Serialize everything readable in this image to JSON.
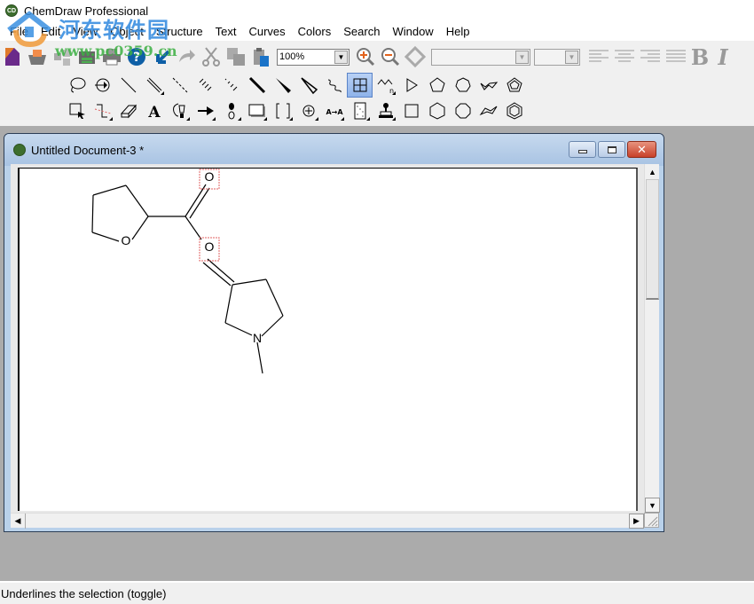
{
  "app": {
    "title": "ChemDraw Professional",
    "logo_text": "CD"
  },
  "menu": {
    "items": [
      "File",
      "Edit",
      "View",
      "Object",
      "Structure",
      "Text",
      "Curves",
      "Colors",
      "Search",
      "Window",
      "Help"
    ]
  },
  "watermark": {
    "cn_text": "河东软件园",
    "url_text": "www.pc0359.cn"
  },
  "toolbar": {
    "buttons": [
      {
        "name": "new-document",
        "icon": "new-document-icon"
      },
      {
        "name": "open",
        "icon": "open-folder-icon"
      },
      {
        "name": "template",
        "icon": "template-icon"
      },
      {
        "name": "save",
        "icon": "save-icon"
      },
      {
        "name": "print",
        "icon": "print-icon"
      },
      {
        "name": "help",
        "icon": "help-icon"
      },
      {
        "name": "undo",
        "icon": "undo-icon"
      },
      {
        "name": "redo",
        "icon": "redo-icon"
      },
      {
        "name": "cut",
        "icon": "scissors-icon"
      },
      {
        "name": "copy",
        "icon": "copy-icon"
      },
      {
        "name": "paste",
        "icon": "paste-icon"
      }
    ],
    "zoom_value": "100%",
    "zoom_in_icon": "zoom-in-icon",
    "zoom_out_icon": "zoom-out-icon",
    "show_crosshair_icon": "diamond-icon",
    "font_value": "",
    "font_size_value": "",
    "align": [
      "align-left",
      "align-center",
      "align-right",
      "justify"
    ],
    "bold_label": "B",
    "italic_label": "I",
    "colors": {
      "accent_blue": "#3a8fe0",
      "disabled_gray": "#9a9a9a"
    }
  },
  "tools": {
    "row1": [
      {
        "name": "lasso",
        "icon": "lasso-icon"
      },
      {
        "name": "structure-perspective",
        "icon": "rotate-3d-icon"
      },
      {
        "name": "solid-bond",
        "icon": "single-bond-icon"
      },
      {
        "name": "multiple-bond",
        "icon": "double-bond-icon",
        "submenu": true
      },
      {
        "name": "dashed-bond",
        "icon": "dashed-bond-icon"
      },
      {
        "name": "hashed-bond",
        "icon": "hashed-bond-icon"
      },
      {
        "name": "hashed-wedged-bond",
        "icon": "hashed-wedge-icon"
      },
      {
        "name": "bold-bond",
        "icon": "bold-bond-icon"
      },
      {
        "name": "wedged-bond",
        "icon": "wedge-bond-icon"
      },
      {
        "name": "hollow-wedged-bond",
        "icon": "hollow-wedge-icon"
      },
      {
        "name": "wavy-bond",
        "icon": "wavy-bond-icon"
      },
      {
        "name": "table",
        "icon": "grid-icon",
        "active": true
      },
      {
        "name": "acyclic-chain",
        "icon": "chain-icon",
        "submenu": true
      },
      {
        "name": "cyclopropane",
        "icon": "triangle-icon"
      },
      {
        "name": "cyclopentane",
        "icon": "pentagon-icon"
      },
      {
        "name": "cycloheptane",
        "icon": "heptagon-icon"
      },
      {
        "name": "cyclohexane-chair-1",
        "icon": "chair-icon"
      },
      {
        "name": "cyclopentadiene",
        "icon": "cyclopentadiene-icon"
      }
    ],
    "row2": [
      {
        "name": "marquee",
        "icon": "marquee-select-icon"
      },
      {
        "name": "mass-fragmentation",
        "icon": "fragmentation-icon",
        "submenu": true
      },
      {
        "name": "eraser",
        "icon": "eraser-icon"
      },
      {
        "name": "text",
        "icon": "text-tool-icon",
        "label": "A"
      },
      {
        "name": "pen",
        "icon": "pen-icon",
        "submenu": true
      },
      {
        "name": "arrow",
        "icon": "arrow-icon",
        "submenu": true
      },
      {
        "name": "orbital",
        "icon": "orbital-icon",
        "submenu": true
      },
      {
        "name": "drawing-elements",
        "icon": "rectangle-icon",
        "submenu": true
      },
      {
        "name": "brackets",
        "icon": "brackets-icon",
        "submenu": true
      },
      {
        "name": "chemical-symbols",
        "icon": "charge-plus-icon",
        "submenu": true
      },
      {
        "name": "query",
        "icon": "atom-map-icon",
        "label": "A→A",
        "submenu": true
      },
      {
        "name": "tlc-plate",
        "icon": "tlc-plate-icon",
        "submenu": true
      },
      {
        "name": "templates",
        "icon": "stamp-icon",
        "submenu": true
      },
      {
        "name": "cyclobutane",
        "icon": "square-icon"
      },
      {
        "name": "cyclohexane",
        "icon": "hexagon-icon"
      },
      {
        "name": "cyclooctane",
        "icon": "octagon-icon"
      },
      {
        "name": "cyclohexane-chair-2",
        "icon": "chair2-icon"
      },
      {
        "name": "benzene",
        "icon": "benzene-icon"
      }
    ]
  },
  "document": {
    "title": "Untitled Document-3 *",
    "controls": {
      "minimize": "minimize-icon",
      "maximize": "restore-icon",
      "close": "close-icon"
    },
    "molecule": {
      "atoms": [
        {
          "id": "O1",
          "label": "O",
          "ring": "tetrahydrofuran"
        },
        {
          "id": "O2",
          "label": "O",
          "role": "carbonyl",
          "selected": true
        },
        {
          "id": "O3",
          "label": "O",
          "role": "ester",
          "selected": true
        },
        {
          "id": "N1",
          "label": "N",
          "ring": "pyrrolidine"
        }
      ],
      "selection_color": "#e06060"
    }
  },
  "statusbar": {
    "text": "Underlines the selection (toggle)"
  }
}
